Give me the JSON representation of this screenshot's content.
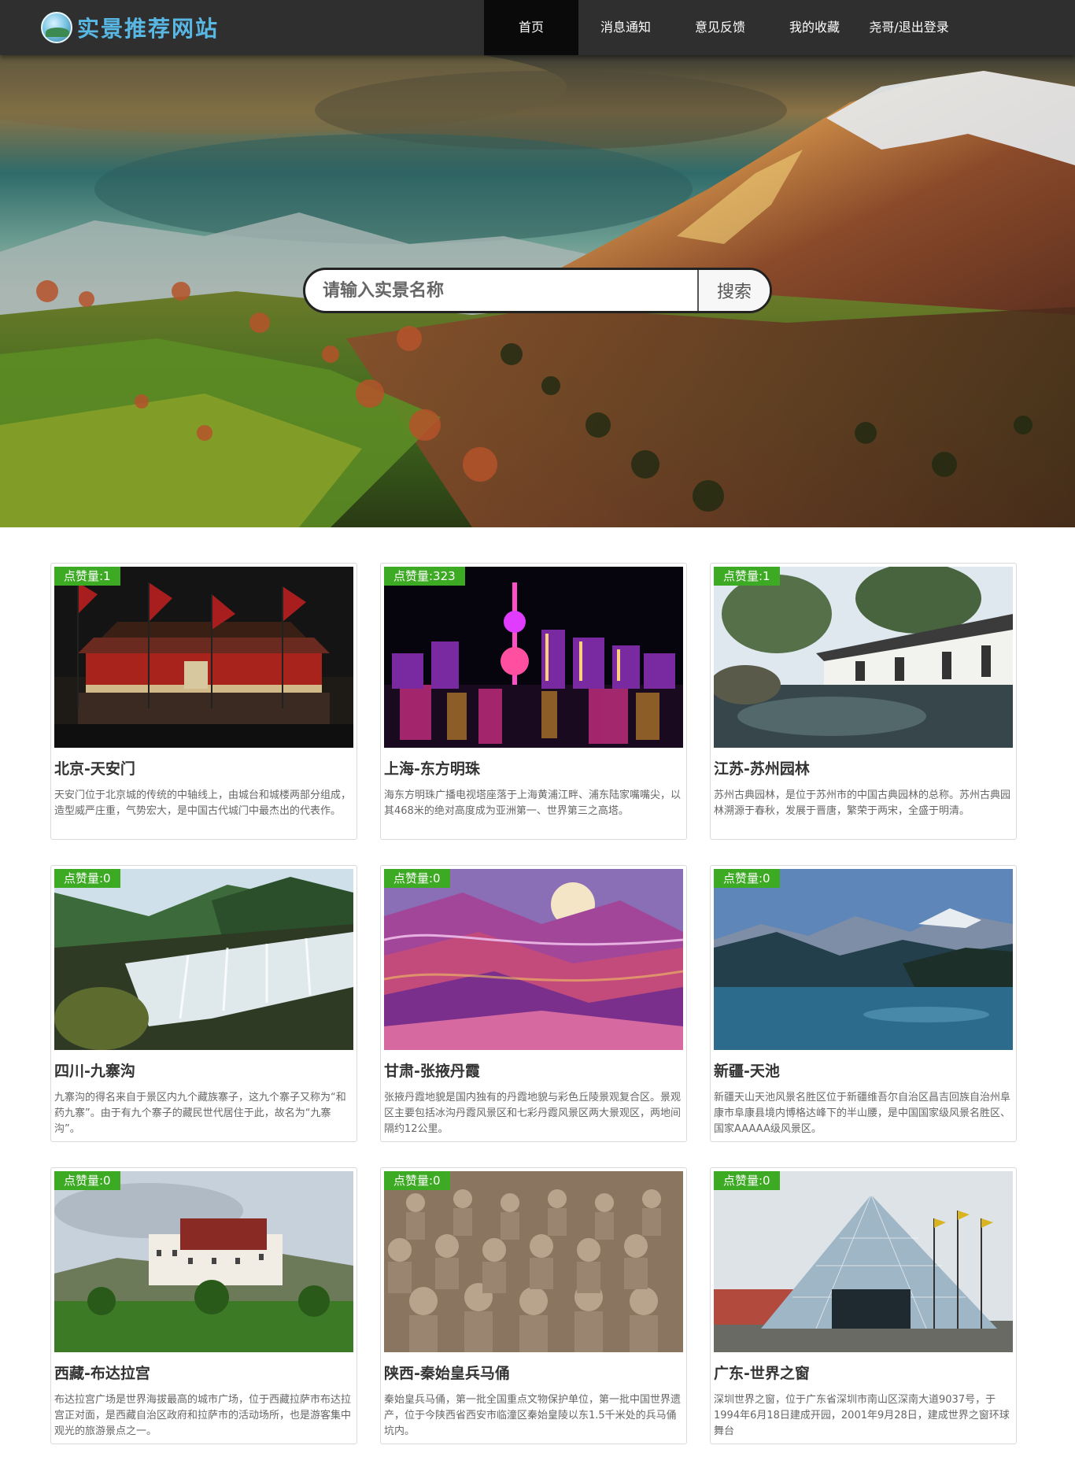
{
  "header": {
    "site_title": "实景推荐网站",
    "nav": [
      {
        "label": "首页",
        "active": true
      },
      {
        "label": "消息通知",
        "active": false
      },
      {
        "label": "意见反馈",
        "active": false
      },
      {
        "label": "我的收藏",
        "active": false
      },
      {
        "label": "尧哥/退出登录",
        "active": false
      }
    ]
  },
  "search": {
    "placeholder": "请输入实景名称",
    "button_label": "搜索"
  },
  "colors": {
    "header_bg": "#2f2f2f",
    "active_nav_bg": "#0a0a0a",
    "logo_text": "#59b7e4",
    "likes_badge": "#3daa24"
  },
  "cards": [
    {
      "likes": "点赞量:1",
      "title": "北京-天安门",
      "desc": "天安门位于北京城的传统的中轴线上，由城台和城楼两部分组成，造型威严庄重，气势宏大，是中国古代城门中最杰出的代表作。"
    },
    {
      "likes": "点赞量:323",
      "title": "上海-东方明珠",
      "desc": "海东方明珠广播电视塔座落于上海黄浦江畔、浦东陆家嘴嘴尖，以其468米的绝对高度成为亚洲第一、世界第三之高塔。"
    },
    {
      "likes": "点赞量:1",
      "title": "江苏-苏州园林",
      "desc": "苏州古典园林，是位于苏州市的中国古典园林的总称。苏州古典园林溯源于春秋，发展于晋唐，繁荣于两宋，全盛于明清。"
    },
    {
      "likes": "点赞量:0",
      "title": "四川-九寨沟",
      "desc": "九寨沟的得名来自于景区内九个藏族寨子，这九个寨子又称为“和药九寨”。由于有九个寨子的藏民世代居住于此，故名为“九寨沟”。"
    },
    {
      "likes": "点赞量:0",
      "title": "甘肃-张掖丹霞",
      "desc": "张掖丹霞地貌是国内独有的丹霞地貌与彩色丘陵景观复合区。景观区主要包括冰沟丹霞风景区和七彩丹霞风景区两大景观区，两地间隔约12公里。"
    },
    {
      "likes": "点赞量:0",
      "title": "新疆-天池",
      "desc": "新疆天山天池风景名胜区位于新疆维吾尔自治区昌吉回族自治州阜康市阜康县境内博格达峰下的半山腰，是中国国家级风景名胜区、国家AAAAA级风景区。"
    },
    {
      "likes": "点赞量:0",
      "title": "西藏-布达拉宫",
      "desc": "布达拉宫广场是世界海拔最高的城市广场，位于西藏拉萨市布达拉宫正对面，是西藏自治区政府和拉萨市的活动场所，也是游客集中观光的旅游景点之一。"
    },
    {
      "likes": "点赞量:0",
      "title": "陕西-秦始皇兵马俑",
      "desc": "秦始皇兵马俑，第一批全国重点文物保护单位，第一批中国世界遗产，位于今陕西省西安市临潼区秦始皇陵以东1.5千米处的兵马俑坑内。"
    },
    {
      "likes": "点赞量:0",
      "title": "广东-世界之窗",
      "desc": "深圳世界之窗，位于广东省深圳市南山区深南大道9037号，于1994年6月18日建成开园，2001年9月28日，建成世界之窗环球舞台"
    }
  ]
}
